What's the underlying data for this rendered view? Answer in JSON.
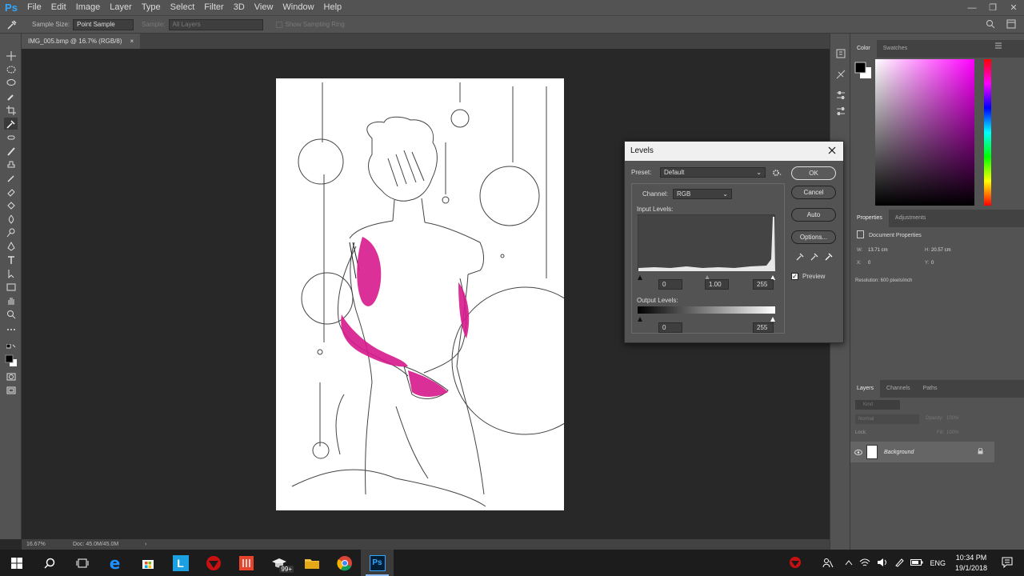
{
  "app": {
    "logo": "Ps",
    "menus": [
      "File",
      "Edit",
      "Image",
      "Layer",
      "Type",
      "Select",
      "Filter",
      "3D",
      "View",
      "Window",
      "Help"
    ]
  },
  "options": {
    "sample_size_label": "Sample Size:",
    "sample_size_value": "Point Sample",
    "sample_label": "Sample:",
    "sample_value": "All Layers",
    "show_ring_label": "Show Sampling Ring"
  },
  "document": {
    "tab_title": "IMG_005.bmp @ 16.7% (RGB/8)",
    "tab_close": "×"
  },
  "status": {
    "zoom": "16.67%",
    "doc_size": "Doc: 45.0M/45.0M",
    "arrow": "›"
  },
  "color_panel": {
    "tabs": [
      "Color",
      "Swatches"
    ]
  },
  "properties_panel": {
    "tabs": [
      "Properties",
      "Adjustments"
    ],
    "title": "Document Properties",
    "w_label": "W:",
    "w_value": "13.71 cm",
    "h_label": "H:",
    "h_value": "20.57 cm",
    "x_label": "X:",
    "x_value": "0",
    "y_label": "Y:",
    "y_value": "0",
    "resolution": "Resolution: 600 pixels/inch"
  },
  "layers_panel": {
    "tabs": [
      "Layers",
      "Channels",
      "Paths"
    ],
    "kind": "Kind",
    "mode": "Normal",
    "opacity_label": "Opacity:",
    "opacity_value": "100%",
    "lock_label": "Lock:",
    "fill_label": "Fill:",
    "fill_value": "100%",
    "layer_name": "Background"
  },
  "levels": {
    "title": "Levels",
    "preset_label": "Preset:",
    "preset_value": "Default",
    "channel_label": "Channel:",
    "channel_value": "RGB",
    "input_label": "Input Levels:",
    "input_black": "0",
    "input_gamma": "1.00",
    "input_white": "255",
    "output_label": "Output Levels:",
    "output_black": "0",
    "output_white": "255",
    "ok": "OK",
    "cancel": "Cancel",
    "auto": "Auto",
    "options": "Options...",
    "preview": "Preview"
  },
  "taskbar": {
    "tray_lang": "ENG",
    "time": "10:34 PM",
    "date": "19/1/2018",
    "badge": "99+"
  },
  "colors": {
    "magenta": "#d6198c",
    "ui_dark": "#282828",
    "ui_panel": "#535353"
  }
}
